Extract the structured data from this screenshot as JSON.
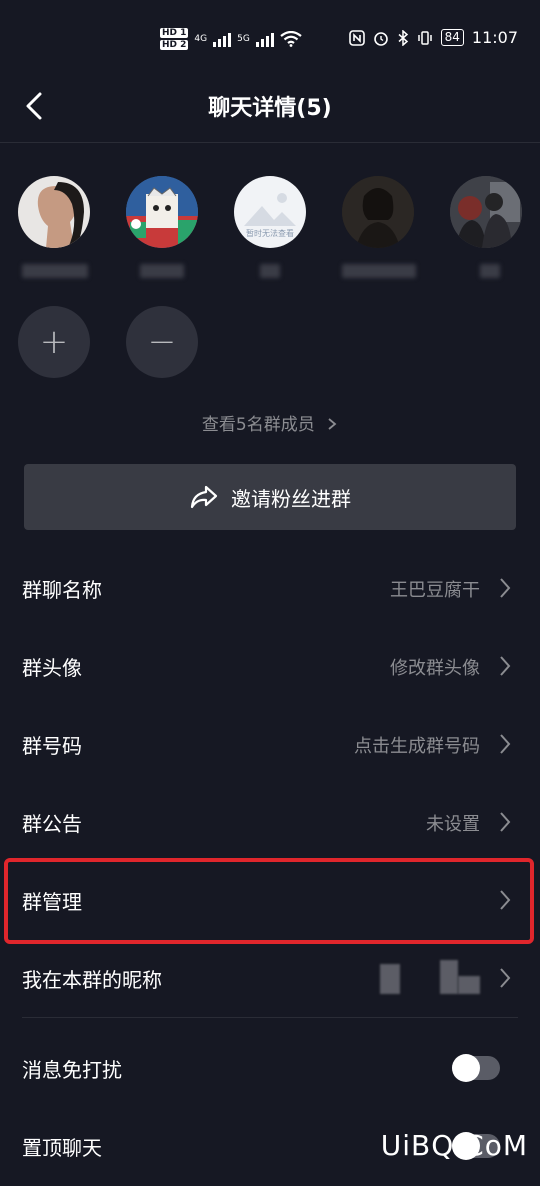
{
  "status_bar": {
    "hd1": "HD 1",
    "hd2": "HD 2",
    "net1": "4G",
    "net2": "5G",
    "battery": "84",
    "time": "11:07"
  },
  "header": {
    "title": "聊天详情(5)"
  },
  "members": {
    "avatars": [
      {
        "icon": "avatar-woman-profile"
      },
      {
        "icon": "avatar-cartoon"
      },
      {
        "icon": "avatar-placeholder",
        "placeholder_text": "暂时无法查看"
      },
      {
        "icon": "avatar-dark-portrait"
      },
      {
        "icon": "avatar-group-photo"
      }
    ],
    "add_symbol": "+",
    "remove_symbol": "−",
    "view_all": "查看5名群成员"
  },
  "invite_button": {
    "label": "邀请粉丝进群"
  },
  "settings": {
    "group_name_label": "群聊名称",
    "group_name_value": "王巴豆腐干",
    "group_avatar_label": "群头像",
    "group_avatar_value": "修改群头像",
    "group_number_label": "群号码",
    "group_number_value": "点击生成群号码",
    "announcement_label": "群公告",
    "announcement_value": "未设置",
    "manage_label": "群管理",
    "nickname_label": "我在本群的昵称",
    "mute_label": "消息免打扰",
    "pin_label": "置顶聊天"
  },
  "watermark": "UiBQ.CoM",
  "colors": {
    "background": "#161823",
    "highlight": "#e0262c",
    "secondary_text": "#8b8c91",
    "invite_bg": "#393b44"
  }
}
